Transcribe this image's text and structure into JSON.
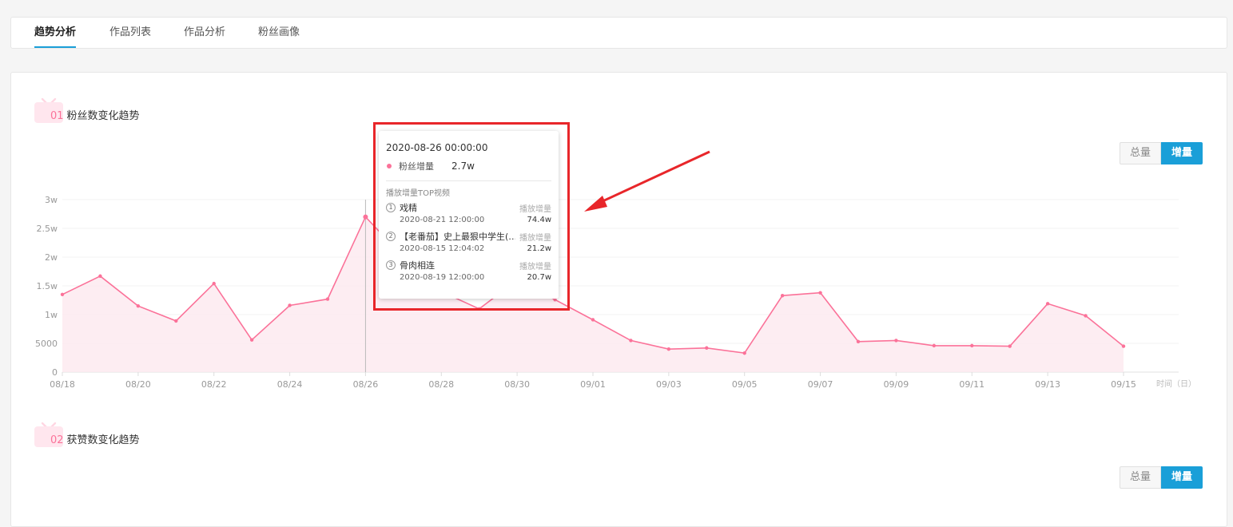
{
  "tabs": [
    {
      "label": "趋势分析",
      "active": true
    },
    {
      "label": "作品列表",
      "active": false
    },
    {
      "label": "作品分析",
      "active": false
    },
    {
      "label": "粉丝画像",
      "active": false
    }
  ],
  "section1": {
    "num": "01",
    "title": "粉丝数变化趋势",
    "toggle": [
      "总量",
      "增量"
    ],
    "active": "增量"
  },
  "section2": {
    "num": "02",
    "title": "获赞数变化趋势",
    "toggle": [
      "总量",
      "增量"
    ],
    "active": "增量"
  },
  "colors": {
    "accent": "#1a9fd8",
    "series": "#fb7299",
    "highlight": "#e8262a"
  },
  "tooltip": {
    "date": "2020-08-26 00:00:00",
    "series_label": "粉丝增量",
    "series_value": "2.7w",
    "top_title": "播放增量TOP视频",
    "videos": [
      {
        "rank": "1",
        "title": "戏精",
        "label": "播放增量",
        "date": "2020-08-21 12:00:00",
        "value": "74.4w"
      },
      {
        "rank": "2",
        "title": "【老番茄】史上最狠中学生(…",
        "label": "播放增量",
        "date": "2020-08-15 12:04:02",
        "value": "21.2w"
      },
      {
        "rank": "3",
        "title": "骨肉相连",
        "label": "播放增量",
        "date": "2020-08-19 12:00:00",
        "value": "20.7w"
      }
    ]
  },
  "chart_data": {
    "type": "area",
    "x": [
      "08/18",
      "08/19",
      "08/20",
      "08/21",
      "08/22",
      "08/23",
      "08/24",
      "08/25",
      "08/26",
      "08/27",
      "08/28",
      "08/29",
      "08/30",
      "08/31",
      "09/01",
      "09/02",
      "09/03",
      "09/04",
      "09/05",
      "09/06",
      "09/07",
      "09/08",
      "09/09",
      "09/10",
      "09/11",
      "09/12",
      "09/13",
      "09/14",
      "09/15"
    ],
    "x_tick_labels": [
      "08/18",
      "08/20",
      "08/22",
      "08/24",
      "08/26",
      "08/28",
      "08/30",
      "09/01",
      "09/03",
      "09/05",
      "09/07",
      "09/09",
      "09/11",
      "09/13",
      "09/15"
    ],
    "series": [
      {
        "values": [
          13500,
          16700,
          11500,
          8900,
          15400,
          5600,
          11600,
          12700,
          27000,
          20000,
          14000,
          11000,
          16000,
          12600,
          9100,
          5500,
          4000,
          4200,
          3300,
          13300,
          13800,
          5300,
          5500,
          4600,
          4600,
          4500,
          11900,
          9800,
          4500
        ]
      }
    ],
    "y_ticks": [
      "0",
      "5000",
      "1w",
      "1.5w",
      "2w",
      "2.5w",
      "3w"
    ],
    "ylim": [
      0,
      30000
    ],
    "xlabel": "时间（日）",
    "grid": true,
    "tooltip_at": "08/26"
  }
}
